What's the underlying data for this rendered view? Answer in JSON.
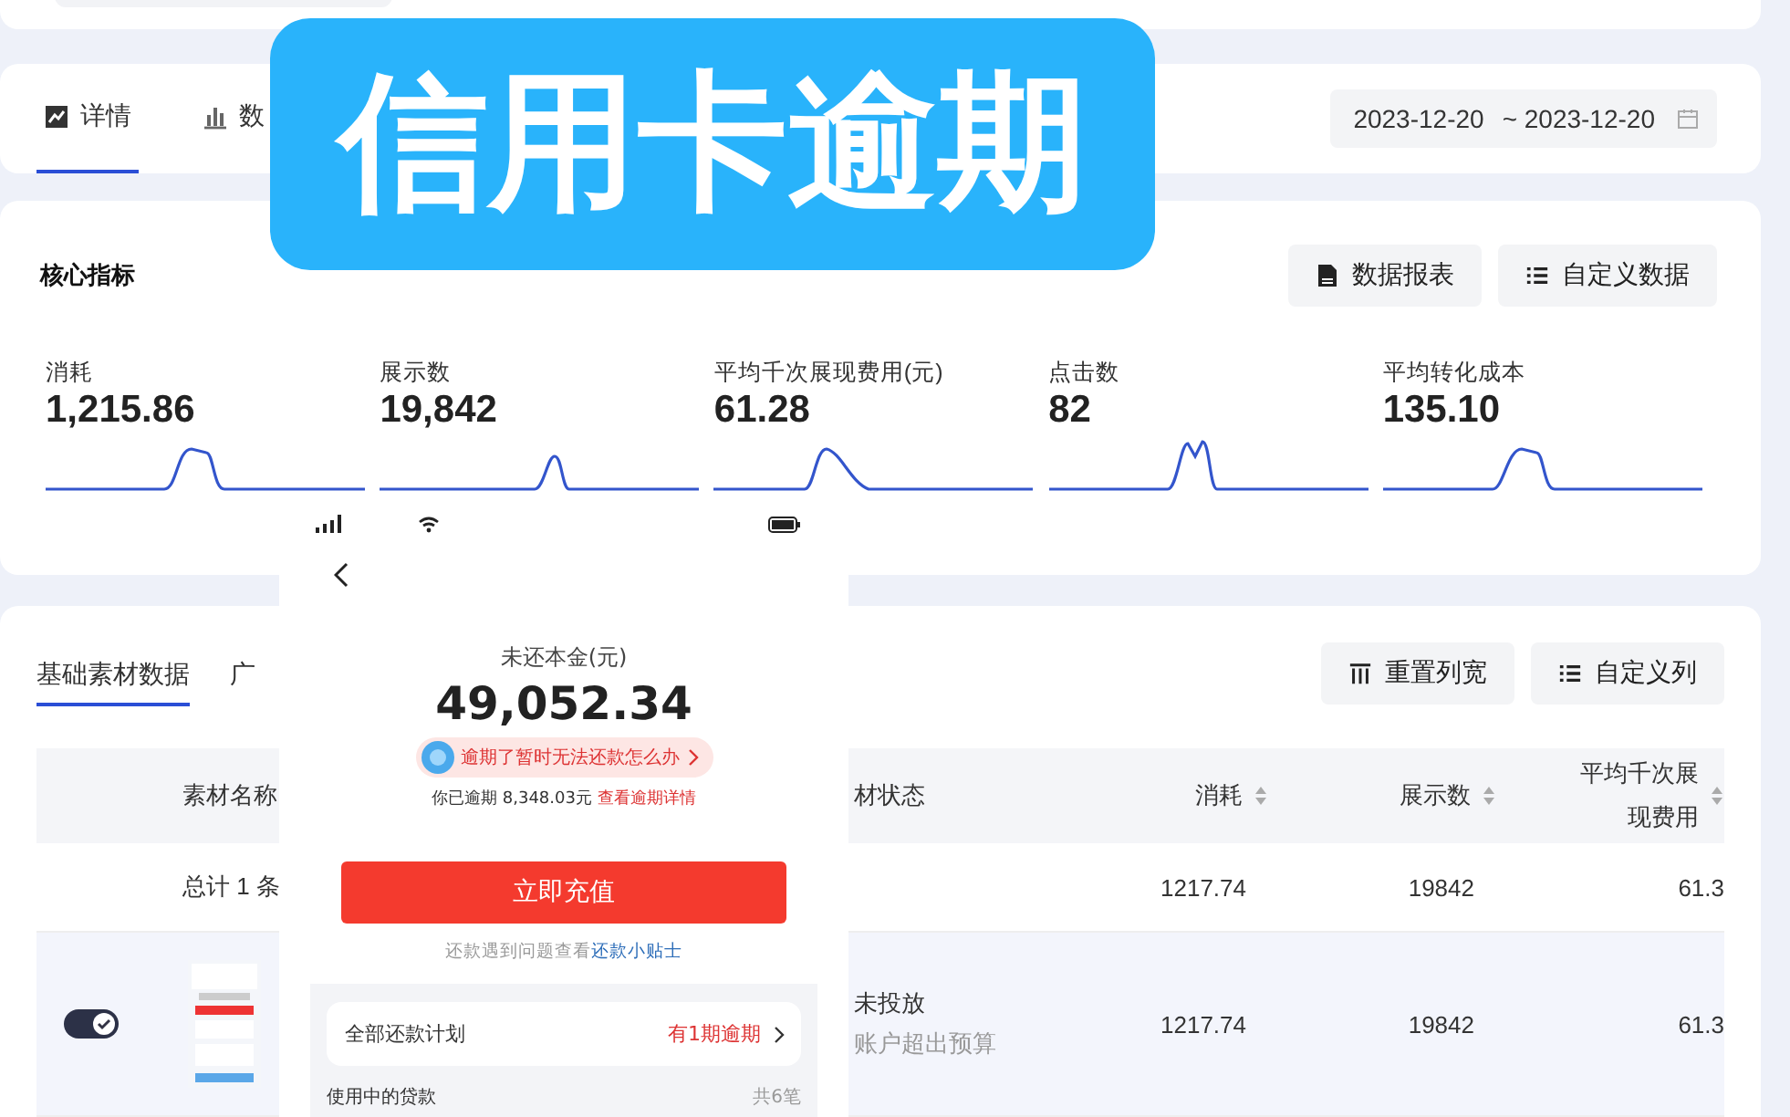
{
  "banner": {
    "title": "信用卡逾期"
  },
  "tabs": [
    {
      "label": "详情",
      "selected": true
    },
    {
      "label": "数",
      "selected": false
    }
  ],
  "date_range": {
    "start": "2023-12-20",
    "end": "~ 2023-12-20"
  },
  "core": {
    "title": "核心指标",
    "buttons": [
      {
        "label": "数据报表"
      },
      {
        "label": "自定义数据"
      }
    ],
    "metrics": [
      {
        "label": "消耗",
        "value": "1,215.86"
      },
      {
        "label": "展示数",
        "value": "19,842"
      },
      {
        "label": "平均千次展现费用(元)",
        "value": "61.28"
      },
      {
        "label": "点击数",
        "value": "82"
      },
      {
        "label": "平均转化成本",
        "value": "135.10"
      }
    ]
  },
  "material": {
    "tabs": [
      {
        "label": "基础素材数据",
        "selected": true
      },
      {
        "label": "广",
        "selected": false
      }
    ],
    "buttons": [
      {
        "label": "重置列宽"
      },
      {
        "label": "自定义列"
      }
    ],
    "columns": [
      "素材名称",
      "材状态",
      "消耗",
      "展示数",
      "平均千次展现费用"
    ],
    "total": {
      "cells": [
        "总计 1 条",
        "",
        "1217.74",
        "19842",
        "61.3"
      ]
    },
    "rows": [
      {
        "on": true,
        "reason": "账户超出预算",
        "cells": [
          "",
          "未投放",
          "1217.74",
          "19842",
          "61.3"
        ]
      }
    ]
  },
  "phone": {
    "amount_label": "未还本金(元)",
    "amount": "49,052.34",
    "tip": "逾期了暂时无法还款怎么办",
    "overdue_text": "你已逾期 8,348.03元",
    "overdue_link": "查看逾期详情",
    "button": "立即充值",
    "help_text": "还款遇到问题查看",
    "help_link": "还款小贴士",
    "plan_label": "全部还款计划",
    "plan_status": "有1期逾期",
    "loans_label": "使用中的贷款",
    "loans_count": "共6笔"
  }
}
